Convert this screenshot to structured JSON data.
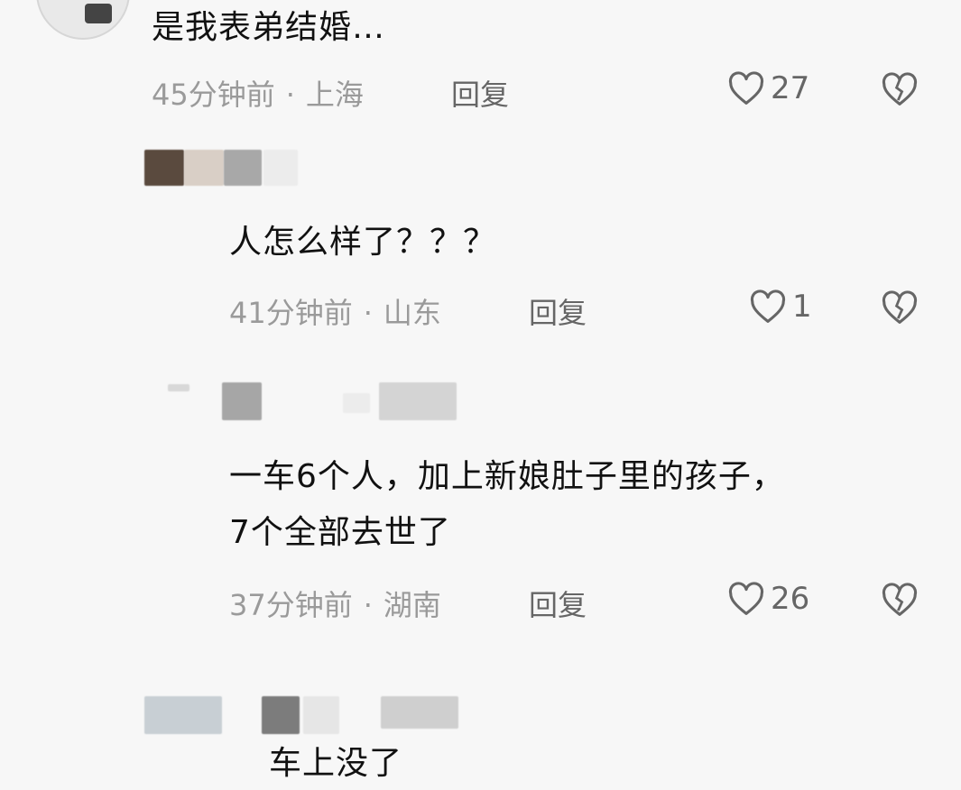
{
  "comments": [
    {
      "text": "是我表弟结婚…",
      "time": "45分钟前",
      "location": "上海",
      "reply_label": "回复",
      "likes": "27"
    },
    {
      "text": "人怎么样了？？？",
      "time": "41分钟前",
      "location": "山东",
      "reply_label": "回复",
      "likes": "1"
    },
    {
      "text_line1": "一车6个人，加上新娘肚子里的孩子，",
      "text_line2": "7个全部去世了",
      "time": "37分钟前",
      "location": "湖南",
      "reply_label": "回复",
      "likes": "26"
    },
    {
      "text": "车上没了"
    }
  ],
  "separator": "·",
  "icons": {
    "like": "heart-outline-icon",
    "dislike": "broken-heart-icon"
  },
  "colors": {
    "background": "#f7f7f7",
    "meta_text": "#9a9a9a",
    "icon": "#666666"
  }
}
